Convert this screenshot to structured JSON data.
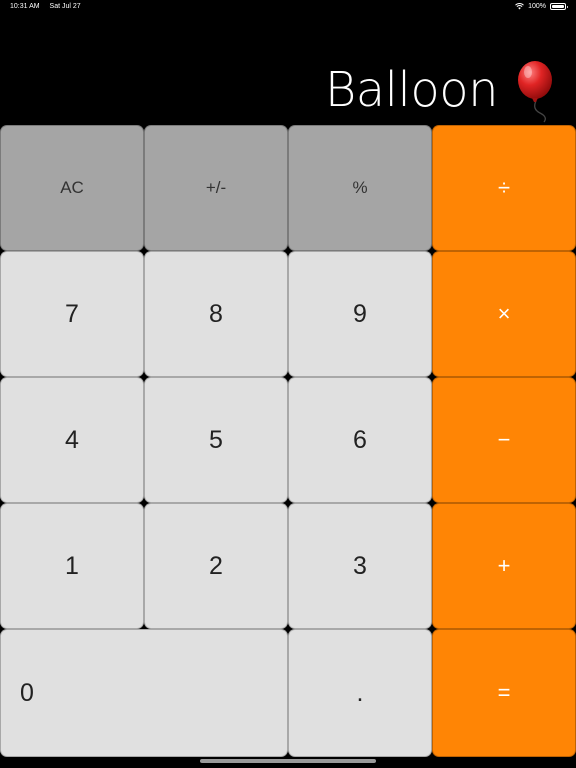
{
  "status_bar": {
    "time": "10:31 AM",
    "date": "Sat Jul 27",
    "battery": "100%",
    "wifi_icon": "wifi-icon",
    "battery_icon": "battery-full-icon"
  },
  "display": {
    "value": "Balloon",
    "emoji_icon": "balloon-icon",
    "balloon_color": "#d81b1b"
  },
  "keys": {
    "ac": "AC",
    "plus_minus": "+/-",
    "percent": "%",
    "divide": "÷",
    "seven": "7",
    "eight": "8",
    "nine": "9",
    "multiply": "×",
    "four": "4",
    "five": "5",
    "six": "6",
    "minus": "−",
    "one": "1",
    "two": "2",
    "three": "3",
    "plus": "+",
    "zero": "0",
    "decimal": ".",
    "equals": "="
  },
  "colors": {
    "background": "#000000",
    "function_key": "#a5a5a5",
    "number_key": "#e0e0e0",
    "operator_key": "#ff8505"
  }
}
